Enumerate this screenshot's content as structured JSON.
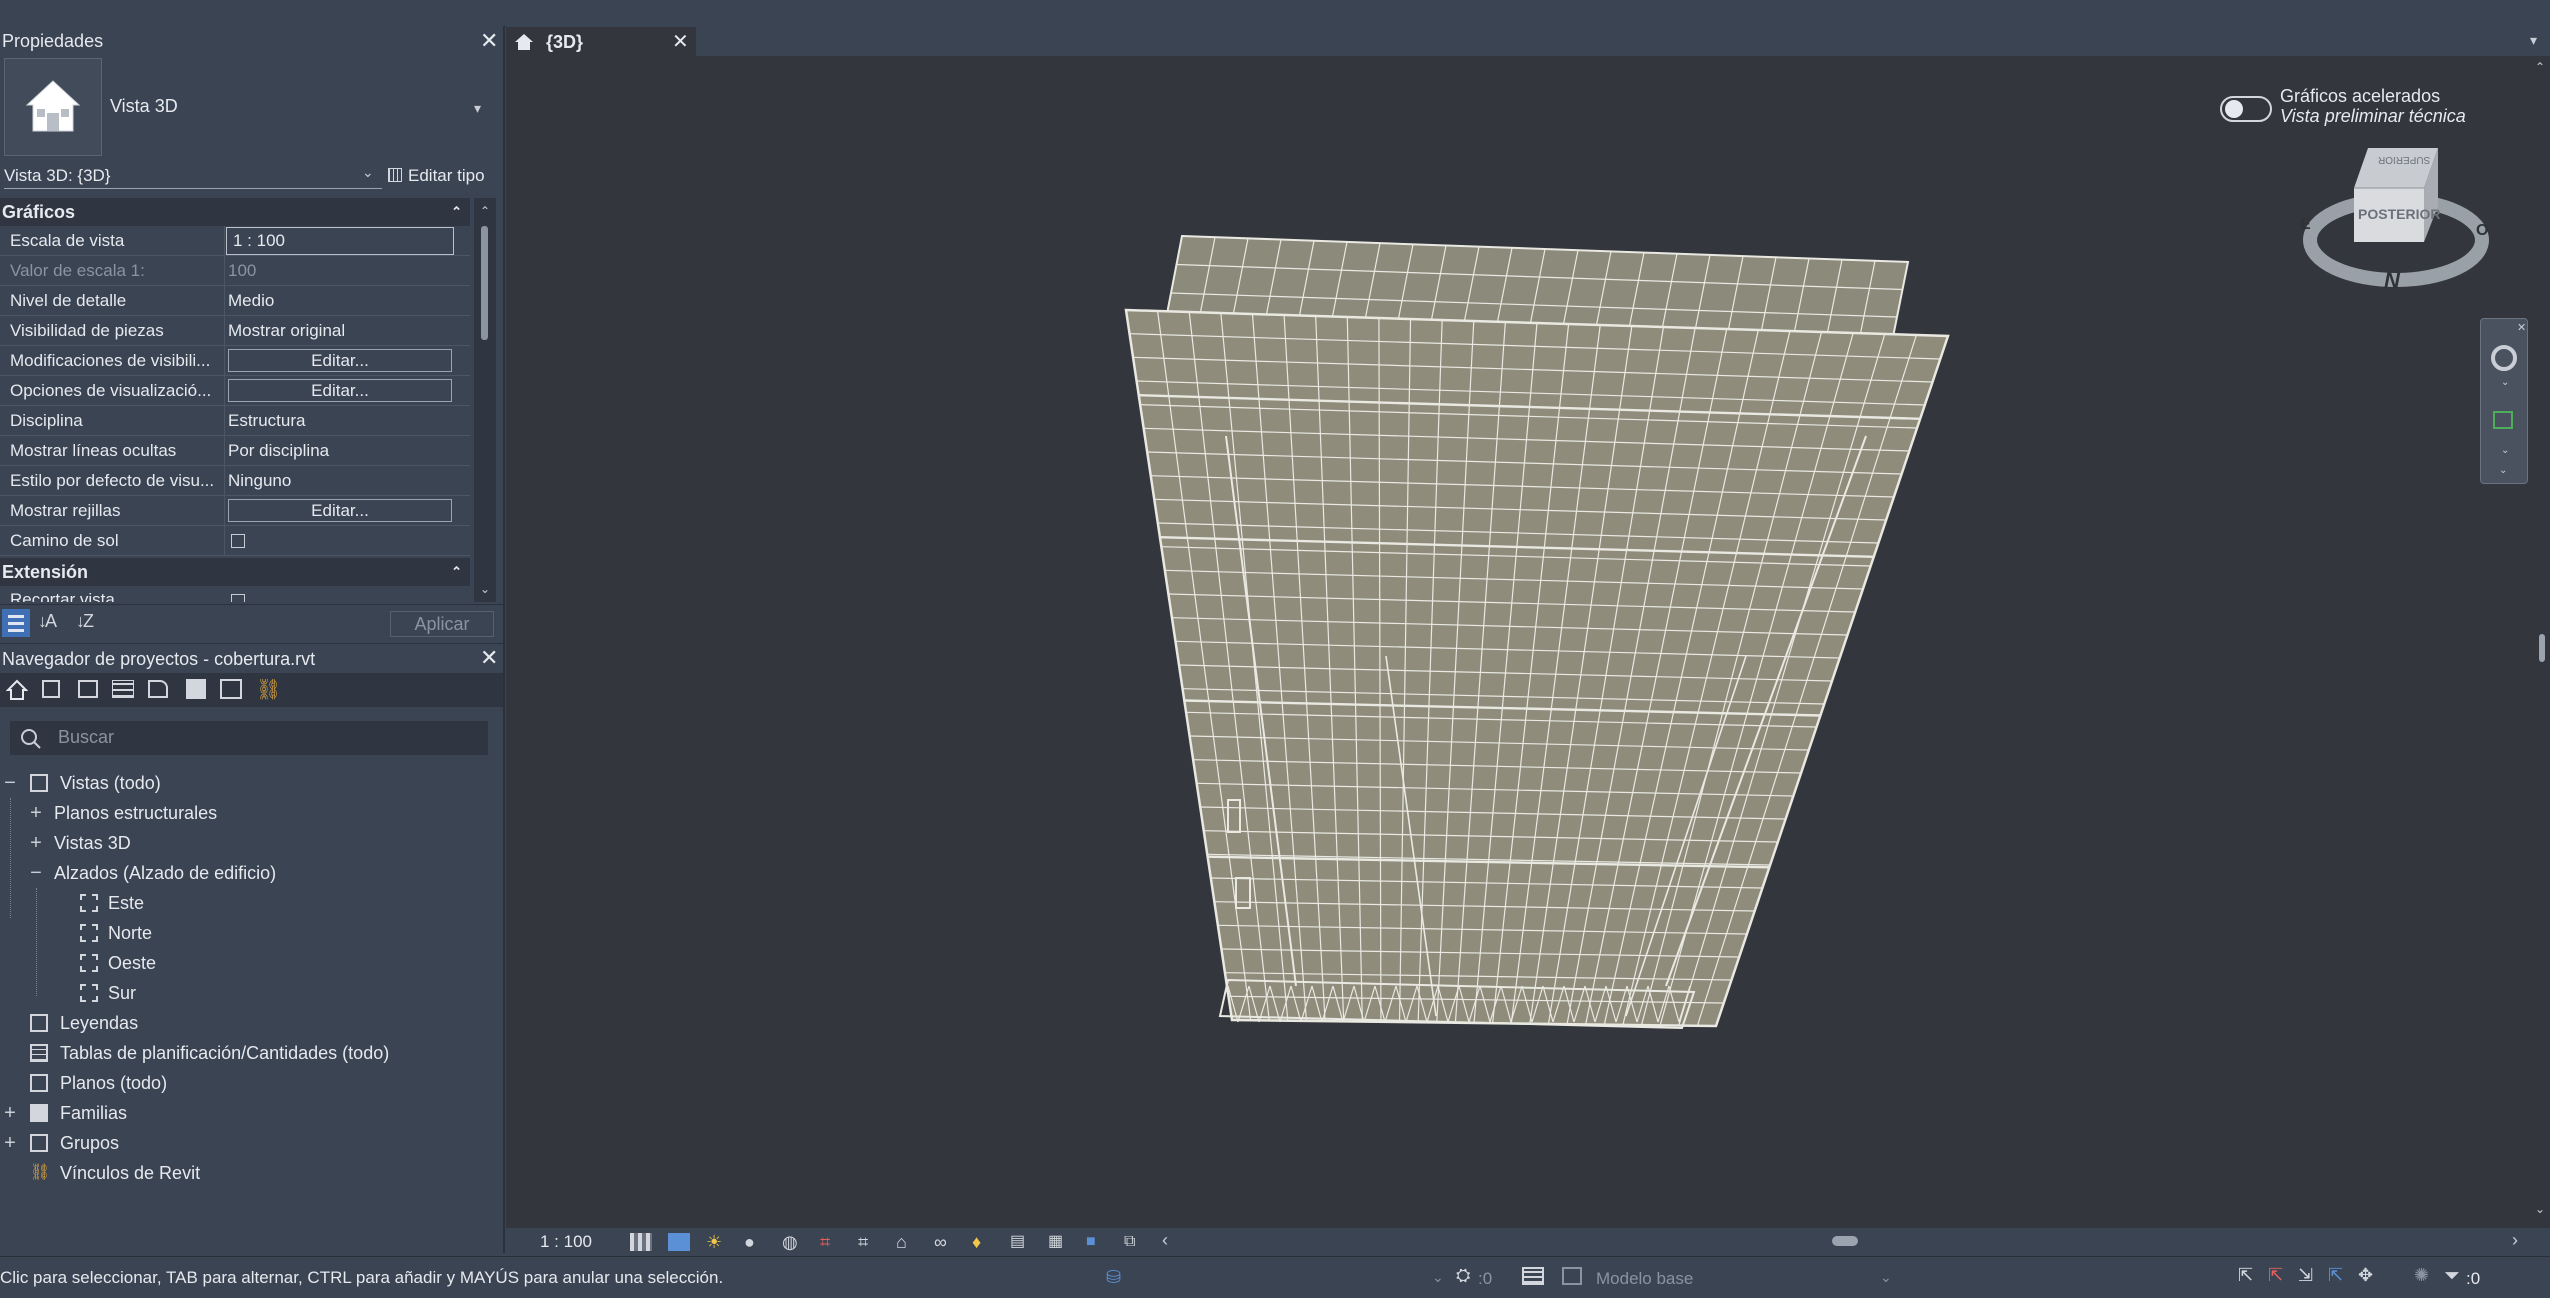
{
  "properties": {
    "title": "Propiedades",
    "type_name": "Vista 3D",
    "instance_selector": "Vista 3D: {3D}",
    "edit_type": "Editar tipo",
    "sections": {
      "graphics": "Gráficos",
      "extent": "Extensión"
    },
    "rows": [
      {
        "name": "Escala de vista",
        "value": "1 : 100"
      },
      {
        "name": "Valor de escala    1:",
        "value": "100"
      },
      {
        "name": "Nivel de detalle",
        "value": "Medio"
      },
      {
        "name": "Visibilidad de piezas",
        "value": "Mostrar original"
      },
      {
        "name": "Modificaciones de visibili...",
        "value": "Editar..."
      },
      {
        "name": "Opciones de visualizació...",
        "value": "Editar..."
      },
      {
        "name": "Disciplina",
        "value": "Estructura"
      },
      {
        "name": "Mostrar líneas ocultas",
        "value": "Por disciplina"
      },
      {
        "name": "Estilo por defecto de visu...",
        "value": "Ninguno"
      },
      {
        "name": "Mostrar rejillas",
        "value": "Editar..."
      },
      {
        "name": "Camino de sol",
        "value": ""
      }
    ],
    "crop_row": "Recortar vista",
    "apply": "Aplicar"
  },
  "browser": {
    "title": "Navegador de proyectos - cobertura.rvt",
    "search_placeholder": "Buscar",
    "tree": [
      {
        "label": "Vistas (todo)",
        "toggle": "−"
      },
      {
        "label": "Planos estructurales",
        "toggle": "+"
      },
      {
        "label": "Vistas 3D",
        "toggle": "+"
      },
      {
        "label": "Alzados (Alzado de edificio)",
        "toggle": "−"
      },
      {
        "label": "Este"
      },
      {
        "label": "Norte"
      },
      {
        "label": "Oeste"
      },
      {
        "label": "Sur"
      },
      {
        "label": "Leyendas"
      },
      {
        "label": "Tablas de planificación/Cantidades (todo)"
      },
      {
        "label": "Planos (todo)"
      },
      {
        "label": "Familias",
        "toggle": "+"
      },
      {
        "label": "Grupos",
        "toggle": "+"
      },
      {
        "label": "Vínculos de Revit"
      }
    ]
  },
  "view": {
    "tab_label": "{3D}",
    "accelerated_graphics": "Gráficos acelerados",
    "preview_mode": "Vista preliminar técnica",
    "viewcube_face": "POSTERIOR",
    "viewcube_top": "SUPERIOR",
    "compass_n": "N",
    "compass_e": "E",
    "compass_o": "O",
    "scale": "1 : 100"
  },
  "status": {
    "hint": "Clic para seleccionar, TAB para alternar, CTRL para añadir y MAYÚS para anular una selección.",
    "count_left": ":0",
    "model": "Modelo base",
    "count_right": ":0"
  },
  "colors": {
    "panel_bg": "#3b4453",
    "viewport_bg": "#33363c",
    "mesh_fill": "#8f8c7c",
    "mesh_line": "#e9e9e2"
  }
}
